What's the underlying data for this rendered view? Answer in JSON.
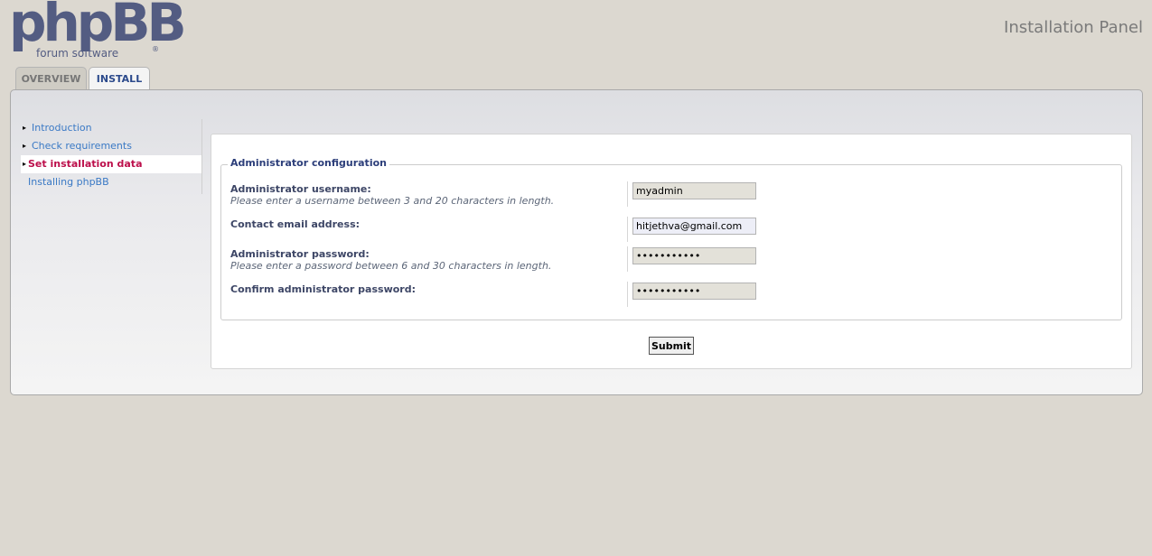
{
  "header": {
    "logo_main": "phpBB",
    "logo_sub": "forum  software",
    "logo_reg": "®",
    "panel_title": "Installation Panel"
  },
  "tabs": [
    {
      "label": "OVERVIEW",
      "active": false
    },
    {
      "label": "INSTALL",
      "active": true
    }
  ],
  "menu": {
    "items": [
      {
        "label": "Introduction",
        "state": "done"
      },
      {
        "label": "Check requirements",
        "state": "done"
      },
      {
        "label": "Set installation data",
        "state": "active"
      },
      {
        "label": "Installing phpBB",
        "state": "pending"
      }
    ],
    "bullet": "▸"
  },
  "form": {
    "legend": "Administrator configuration",
    "fields": [
      {
        "label": "Administrator username:",
        "hint": "Please enter a username between 3 and 20 characters in length.",
        "value": "myadmin",
        "type": "text"
      },
      {
        "label": "Contact email address:",
        "hint": "",
        "value": "hitjethva@gmail.com",
        "type": "text"
      },
      {
        "label": "Administrator password:",
        "hint": "Please enter a password between 6 and 30 characters in length.",
        "value": "hitjethva11",
        "type": "password"
      },
      {
        "label": "Confirm administrator password:",
        "hint": "",
        "value": "hitjethva11",
        "type": "password"
      }
    ],
    "submit_label": "Submit"
  },
  "colors": {
    "page_bg": "#DCD8D0",
    "logo": "#535C82",
    "link": "#3A79C5",
    "active_link": "#BC0F4B",
    "legend": "#2C3E7A"
  }
}
